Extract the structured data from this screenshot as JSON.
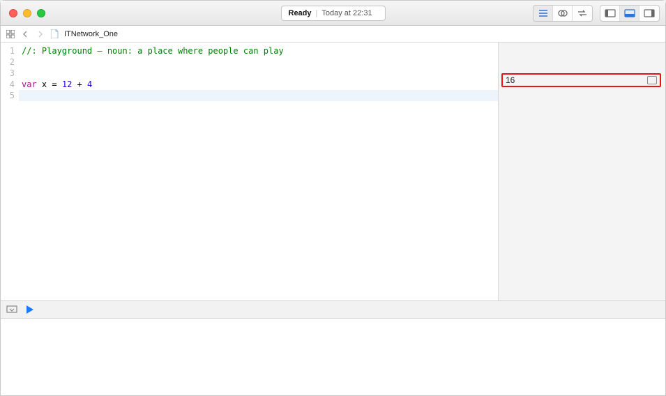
{
  "titlebar": {
    "status": "Ready",
    "timestamp": "Today at 22:31"
  },
  "breadcrumb": {
    "file_name": "ITNetwork_One"
  },
  "code": {
    "lines": [
      {
        "n": "1",
        "segments": [
          {
            "t": "//: Playground – noun: a place where people can play",
            "cls": "tok-comment"
          }
        ]
      },
      {
        "n": "2",
        "segments": []
      },
      {
        "n": "3",
        "segments": []
      },
      {
        "n": "4",
        "segments": [
          {
            "t": "var",
            "cls": "tok-keyword"
          },
          {
            "t": " x ",
            "cls": "tok-ident"
          },
          {
            "t": "=",
            "cls": "tok-op"
          },
          {
            "t": " ",
            "cls": "tok-ident"
          },
          {
            "t": "12",
            "cls": "tok-number"
          },
          {
            "t": " ",
            "cls": "tok-ident"
          },
          {
            "t": "+",
            "cls": "tok-op"
          },
          {
            "t": " ",
            "cls": "tok-ident"
          },
          {
            "t": "4",
            "cls": "tok-number"
          }
        ]
      },
      {
        "n": "5",
        "segments": [],
        "current": true
      }
    ]
  },
  "results": {
    "value": "16"
  }
}
